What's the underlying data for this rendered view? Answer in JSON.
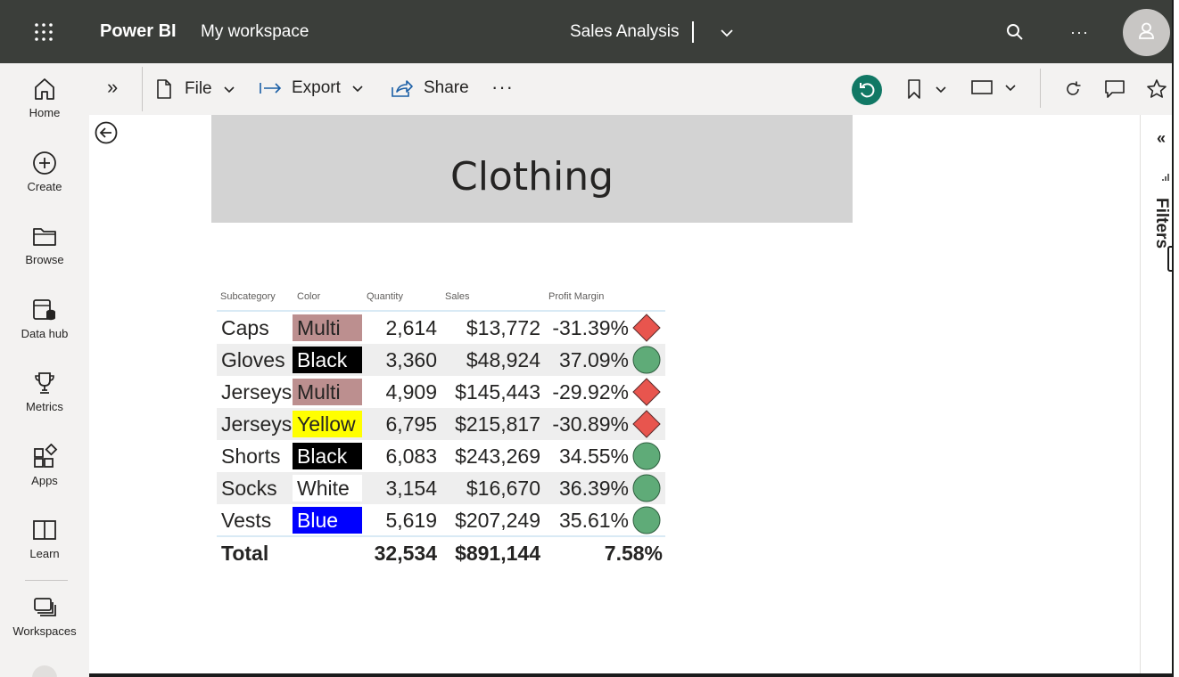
{
  "header": {
    "brand": "Power BI",
    "workspace": "My workspace",
    "report_title": "Sales Analysis",
    "icons": [
      "waffle-icon",
      "chevron-down-icon",
      "search-icon",
      "more-icon",
      "avatar-icon"
    ],
    "more_label": "···"
  },
  "nav": {
    "items": [
      {
        "label": "Home",
        "icon": "home-icon"
      },
      {
        "label": "Create",
        "icon": "create-icon"
      },
      {
        "label": "Browse",
        "icon": "browse-icon"
      },
      {
        "label": "Data hub",
        "icon": "data-hub-icon"
      },
      {
        "label": "Metrics",
        "icon": "trophy-icon"
      },
      {
        "label": "Apps",
        "icon": "apps-icon"
      },
      {
        "label": "Learn",
        "icon": "book-icon"
      },
      {
        "label": "Workspaces",
        "icon": "workspaces-icon"
      }
    ]
  },
  "toolbar": {
    "expand_label": "»",
    "file_label": "File",
    "export_label": "Export",
    "share_label": "Share",
    "more_label": "···",
    "icons": [
      "document-icon",
      "export-icon",
      "share-icon",
      "undo-icon",
      "bookmark-icon",
      "view-icon",
      "refresh-icon",
      "comment-icon",
      "favorite-icon"
    ]
  },
  "report": {
    "banner_title": "Clothing",
    "filters_label": "Filters",
    "collapse_label": "«"
  },
  "matrix": {
    "headers": {
      "subcategory": "Subcategory",
      "color": "Color",
      "quantity": "Quantity",
      "sales": "Sales",
      "profit_margin": "Profit Margin"
    },
    "rows": [
      {
        "subcategory": "Caps",
        "color": "Multi",
        "quantity": "2,614",
        "sales": "$13,772",
        "profit_margin": "-31.39%",
        "indicator": "red-diamond-icon"
      },
      {
        "subcategory": "Gloves",
        "color": "Black",
        "quantity": "3,360",
        "sales": "$48,924",
        "profit_margin": "37.09%",
        "indicator": "green-circle-icon"
      },
      {
        "subcategory": "Jerseys",
        "color": "Multi",
        "quantity": "4,909",
        "sales": "$145,443",
        "profit_margin": "-29.92%",
        "indicator": "red-diamond-icon"
      },
      {
        "subcategory": "Jerseys",
        "color": "Yellow",
        "quantity": "6,795",
        "sales": "$215,817",
        "profit_margin": "-30.89%",
        "indicator": "red-diamond-icon"
      },
      {
        "subcategory": "Shorts",
        "color": "Black",
        "quantity": "6,083",
        "sales": "$243,269",
        "profit_margin": "34.55%",
        "indicator": "green-circle-icon"
      },
      {
        "subcategory": "Socks",
        "color": "White",
        "quantity": "3,154",
        "sales": "$16,670",
        "profit_margin": "36.39%",
        "indicator": "green-circle-icon"
      },
      {
        "subcategory": "Vests",
        "color": "Blue",
        "quantity": "5,619",
        "sales": "$207,249",
        "profit_margin": "35.61%",
        "indicator": "green-circle-icon"
      }
    ],
    "total": {
      "label": "Total",
      "quantity": "32,534",
      "sales": "$891,144",
      "profit_margin": "7.58%"
    },
    "color_swatches": {
      "Multi": {
        "bg": "#bc8f8f",
        "fg": "#252423"
      },
      "Black": {
        "bg": "#000000",
        "fg": "#ffffff"
      },
      "Yellow": {
        "bg": "#ffff00",
        "fg": "#252423"
      },
      "White": {
        "bg": "#ffffff",
        "fg": "#252423"
      },
      "Blue": {
        "bg": "#0000ff",
        "fg": "#ffffff"
      }
    },
    "indicator_colors": {
      "negative": "#e8554e",
      "positive": "#5fab78"
    }
  },
  "colors": {
    "header_bg": "#3b3e3a",
    "nav_bg": "#f3f2f1",
    "accent_undo": "#117865",
    "banner_bg": "#d3d3d3"
  }
}
